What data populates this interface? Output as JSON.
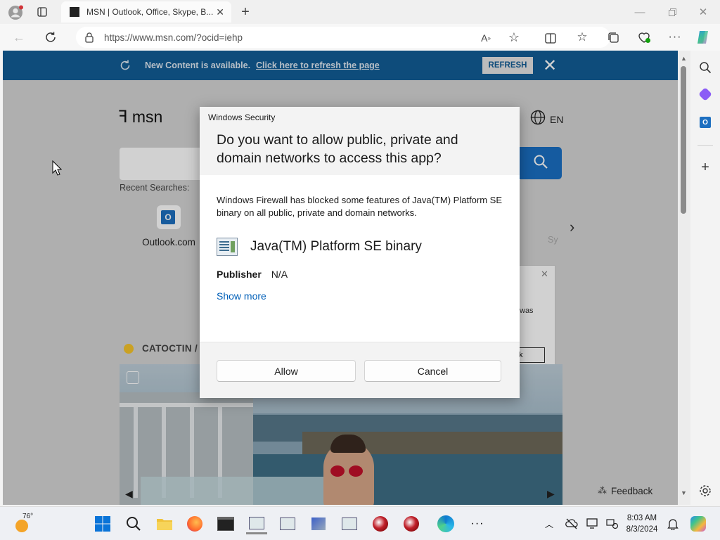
{
  "browser": {
    "tab_title": "MSN | Outlook, Office, Skype, B...",
    "url": "https://www.msn.com/?ocid=iehp"
  },
  "banner": {
    "text": "New Content is available.",
    "link": "Click here to refresh the page",
    "refresh_label": "REFRESH"
  },
  "msn": {
    "logo": "msn",
    "language": "EN",
    "recent_searches": "Recent Searches:",
    "tile_outlook": "Outlook.com",
    "tile_partial": "Sy",
    "weather_location": "CATOCTIN /",
    "feedback": "Feedback",
    "partial_popup_text": "was",
    "partial_popup_btn": "k"
  },
  "dialog": {
    "window_title": "Windows Security",
    "heading": "Do you want to allow public, private and domain networks to access this app?",
    "body": "Windows Firewall has blocked some features of Java(TM) Platform SE binary on all public, private and domain networks.",
    "app_name": "Java(TM) Platform SE binary",
    "publisher_label": "Publisher",
    "publisher_value": "N/A",
    "show_more": "Show more",
    "allow": "Allow",
    "cancel": "Cancel"
  },
  "taskbar": {
    "temperature": "76°",
    "time": "8:03 AM",
    "date": "8/3/2024"
  },
  "colors": {
    "banner": "#125d96",
    "link": "#005fb8",
    "search_button": "#1a6fc4"
  }
}
